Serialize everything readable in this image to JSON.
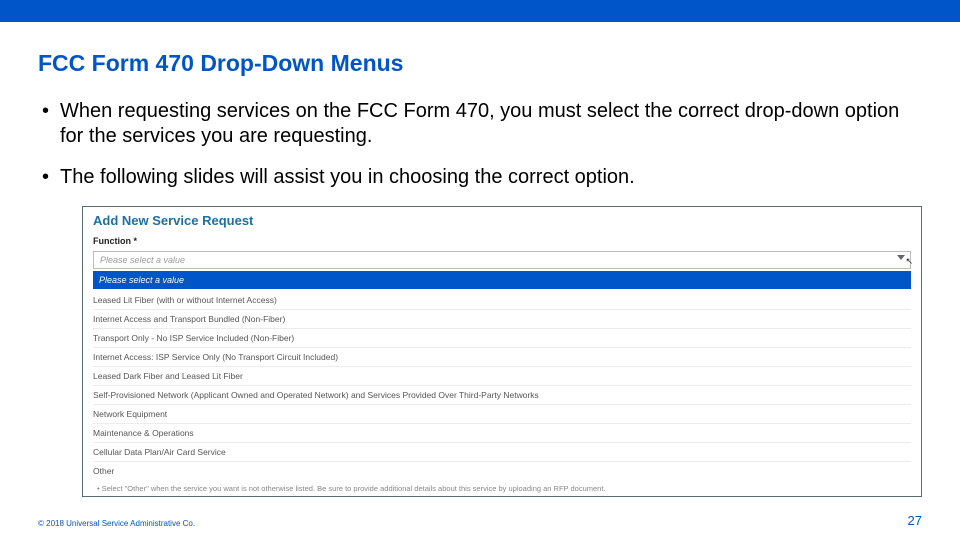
{
  "title": "FCC Form 470 Drop-Down Menus",
  "bullets": [
    "When requesting services on the FCC Form 470, you must select the correct drop-down option for the services you are requesting.",
    "The following slides will assist you in choosing the correct option."
  ],
  "screenshot": {
    "heading": "Add New Service Request",
    "field_label": "Function *",
    "placeholder": "Please select a value",
    "selected": "Please select a value",
    "options": [
      "Leased Lit Fiber (with or without Internet Access)",
      "Internet Access and Transport Bundled (Non-Fiber)",
      "Transport Only - No ISP Service Included (Non-Fiber)",
      "Internet Access: ISP Service Only (No Transport Circuit Included)",
      "Leased Dark Fiber and Leased Lit Fiber",
      "Self-Provisioned Network (Applicant Owned and Operated Network) and Services Provided Over Third-Party Networks",
      "Network Equipment",
      "Maintenance & Operations",
      "Cellular Data Plan/Air Card Service",
      "Other"
    ],
    "note": "Select \"Other\" when the service you want is not otherwise listed. Be sure to provide additional details about this service by uploading an RFP document."
  },
  "footer": {
    "copyright": "© 2018 Universal Service Administrative Co.",
    "page": "27"
  }
}
